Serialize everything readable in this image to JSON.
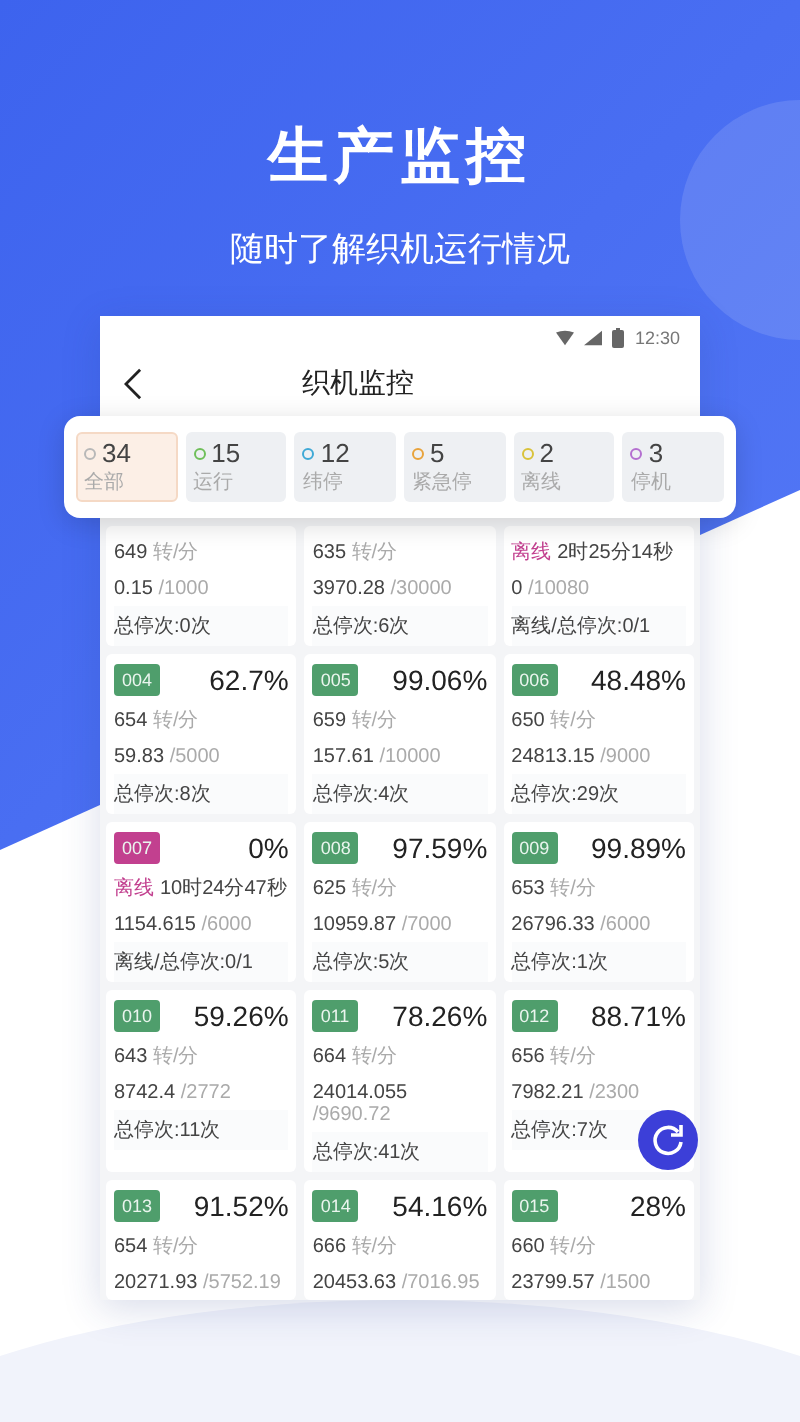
{
  "header": {
    "title": "生产监控",
    "subtitle": "随时了解织机运行情况"
  },
  "phone": {
    "time": "12:30",
    "title": "织机监控"
  },
  "filters": [
    {
      "count": "34",
      "label": "全部",
      "color": "#b8b8b8",
      "selected": true
    },
    {
      "count": "15",
      "label": "运行",
      "color": "#6fbf5a",
      "selected": false
    },
    {
      "count": "12",
      "label": "纬停",
      "color": "#3fa9d6",
      "selected": false
    },
    {
      "count": "5",
      "label": "紧急停",
      "color": "#e8a33c",
      "selected": false
    },
    {
      "count": "2",
      "label": "离线",
      "color": "#d9c23a",
      "selected": false
    },
    {
      "count": "3",
      "label": "停机",
      "color": "#b46fd0",
      "selected": false
    }
  ],
  "machines": [
    {
      "kind": "speed",
      "speed": "649",
      "unit": "转/分",
      "output": "0.15",
      "target": "/1000",
      "stops": "总停次:0次"
    },
    {
      "kind": "speed",
      "speed": "635",
      "unit": "转/分",
      "output": "3970.28",
      "target": "/30000",
      "stops": "总停次:6次"
    },
    {
      "kind": "offline",
      "status": "离线",
      "duration": "2时25分14秒",
      "output": "0",
      "target": "/10080",
      "stops": "离线/总停次:0/1"
    },
    {
      "kind": "speed",
      "id": "004",
      "color": "#4f9e6c",
      "percent": "62.7%",
      "speed": "654",
      "unit": "转/分",
      "output": "59.83",
      "target": "/5000",
      "stops": "总停次:8次"
    },
    {
      "kind": "speed",
      "id": "005",
      "color": "#4f9e6c",
      "percent": "99.06%",
      "speed": "659",
      "unit": "转/分",
      "output": "157.61",
      "target": "/10000",
      "stops": "总停次:4次"
    },
    {
      "kind": "speed",
      "id": "006",
      "color": "#4f9e6c",
      "percent": "48.48%",
      "speed": "650",
      "unit": "转/分",
      "output": "24813.15",
      "target": "/9000",
      "stops": "总停次:29次"
    },
    {
      "kind": "offline",
      "id": "007",
      "color": "#c2408f",
      "percent": "0%",
      "status": "离线",
      "duration": "10时24分47秒",
      "output": "1154.615",
      "target": "/6000",
      "stops": "离线/总停次:0/1"
    },
    {
      "kind": "speed",
      "id": "008",
      "color": "#4f9e6c",
      "percent": "97.59%",
      "speed": "625",
      "unit": "转/分",
      "output": "10959.87",
      "target": "/7000",
      "stops": "总停次:5次"
    },
    {
      "kind": "speed",
      "id": "009",
      "color": "#4f9e6c",
      "percent": "99.89%",
      "speed": "653",
      "unit": "转/分",
      "output": "26796.33",
      "target": "/6000",
      "stops": "总停次:1次"
    },
    {
      "kind": "speed",
      "id": "010",
      "color": "#4f9e6c",
      "percent": "59.26%",
      "speed": "643",
      "unit": "转/分",
      "output": "8742.4",
      "target": "/2772",
      "stops": "总停次:11次"
    },
    {
      "kind": "speed",
      "id": "011",
      "color": "#4f9e6c",
      "percent": "78.26%",
      "speed": "664",
      "unit": "转/分",
      "output": "24014.055",
      "target": "/9690.72",
      "stops": "总停次:41次"
    },
    {
      "kind": "speed",
      "id": "012",
      "color": "#4f9e6c",
      "percent": "88.71%",
      "speed": "656",
      "unit": "转/分",
      "output": "7982.21",
      "target": "/2300",
      "stops": "总停次:7次"
    },
    {
      "kind": "speed",
      "id": "013",
      "color": "#4f9e6c",
      "percent": "91.52%",
      "speed": "654",
      "unit": "转/分",
      "output": "20271.93",
      "target": "/5752.19"
    },
    {
      "kind": "speed",
      "id": "014",
      "color": "#4f9e6c",
      "percent": "54.16%",
      "speed": "666",
      "unit": "转/分",
      "output": "20453.63",
      "target": "/7016.95"
    },
    {
      "kind": "speed",
      "id": "015",
      "color": "#4f9e6c",
      "percent": "28%",
      "speed": "660",
      "unit": "转/分",
      "output": "23799.57",
      "target": "/1500"
    }
  ]
}
